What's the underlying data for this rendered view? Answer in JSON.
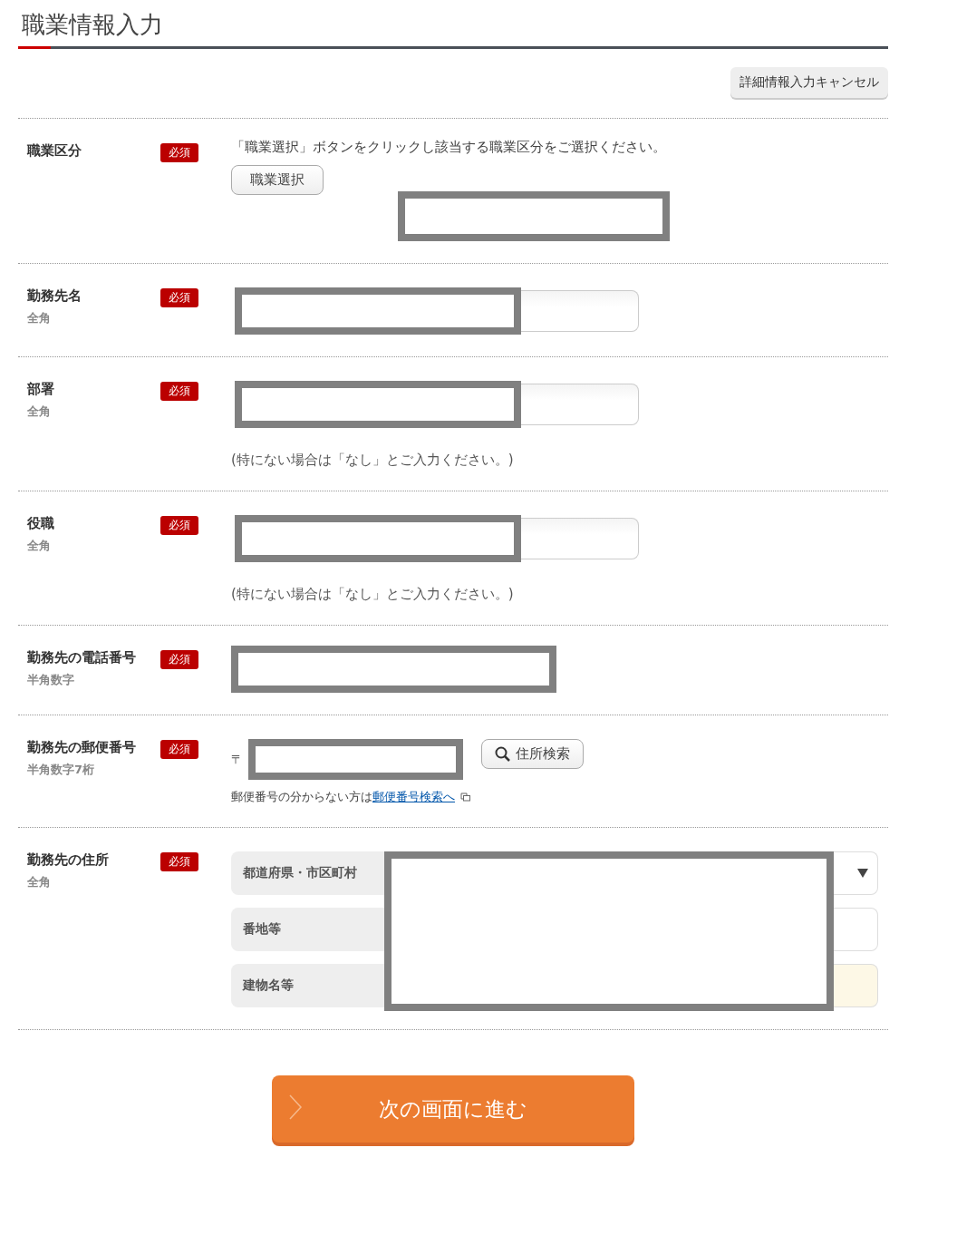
{
  "title": "職業情報入力",
  "cancel_button": "詳細情報入力キャンセル",
  "fields": [
    {
      "kind": "select",
      "label": "職業区分",
      "badge": "必須",
      "instruction": "「職業選択」ボタンをクリックし該当する職業区分をご選択ください。",
      "button": "職業選択",
      "redacted": true
    },
    {
      "kind": "text",
      "label": "勤務先名",
      "sub": "全角",
      "badge": "必須",
      "redacted": true
    },
    {
      "kind": "text",
      "label": "部署",
      "sub": "全角",
      "badge": "必須",
      "hint": "(特にない場合は「なし」とご入力ください。)",
      "redacted": true
    },
    {
      "kind": "text",
      "label": "役職",
      "sub": "全角",
      "badge": "必須",
      "hint": "(特にない場合は「なし」とご入力ください。)",
      "redacted": true
    },
    {
      "kind": "phone",
      "label": "勤務先の電話番号",
      "sub": "半角数字",
      "badge": "必須",
      "redacted": true
    },
    {
      "kind": "zip",
      "label": "勤務先の郵便番号",
      "sub": "半角数字7桁",
      "badge": "必須",
      "mark": "〒",
      "button": "住所検索",
      "note": "郵便番号の分からない方は",
      "link": "郵便番号検索へ",
      "redacted": true
    },
    {
      "kind": "address",
      "label": "勤務先の住所",
      "sub": "全角",
      "badge": "必須",
      "parts": [
        {
          "label": "都道府県・市区町村",
          "kind": "dropdown"
        },
        {
          "label": "番地等",
          "kind": "input"
        },
        {
          "label": "建物名等",
          "kind": "optional"
        }
      ],
      "redacted": true
    }
  ],
  "next_button": "次の画面に進む"
}
